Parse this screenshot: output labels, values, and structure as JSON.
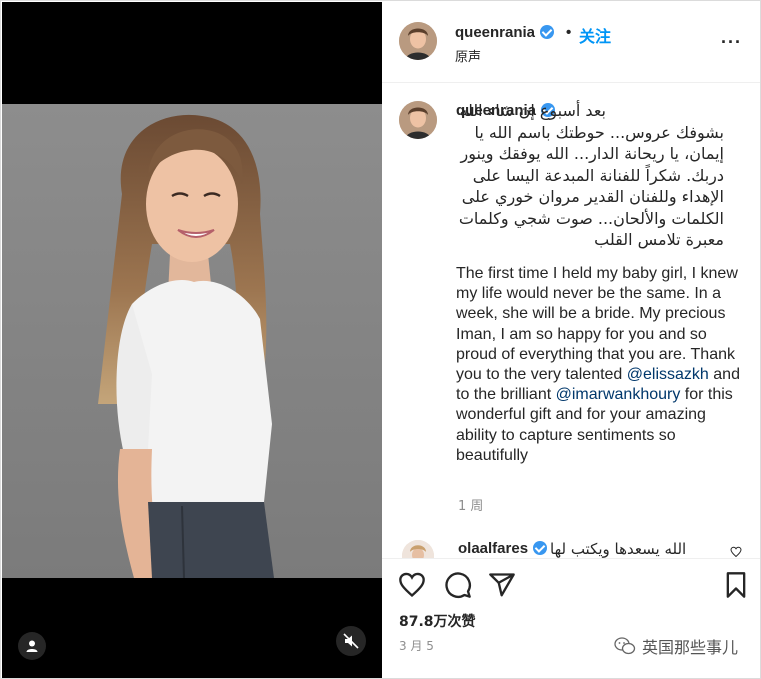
{
  "header": {
    "username": "queenrania",
    "dot": "•",
    "follow_label": "关注",
    "subtitle": "原声",
    "more": "..."
  },
  "caption": {
    "username": "queenrania",
    "arabic_text": "بعد أسبوع إن شاء الله بشوفك عروس... حوطتك باسم الله يا إيمان، يا ريحانة الدار... الله يوفقك وينور دربك. شكراً للفنانة المبدعة اليسا على الإهداء وللفنان القدير مروان خوري على الكلمات والألحان... صوت شجي وكلمات معبرة تلامس القلب",
    "english_1": "The first time I held my baby girl, I knew my life would never be the same. In a week, she will be a bride. My precious Iman, I am so happy for you and so proud of everything that you are. Thank you to the very talented ",
    "mention_1": "@elissazkh",
    "english_2": " and to the brilliant ",
    "mention_2": "@imarwankhoury",
    "english_3": " for this wonderful gift and for your amazing ability to capture sentiments so beautifully",
    "time_ago": "1 周"
  },
  "comment": {
    "username": "olaalfares",
    "text": "الله يسعدها ويكتب لها"
  },
  "footer": {
    "likes": "87.8万次赞",
    "date": "3 月 5",
    "watermark": "英国那些事儿"
  },
  "icons": {
    "like": "heart-icon",
    "comment": "comment-icon",
    "share": "share-icon",
    "save": "bookmark-icon",
    "tag": "user-tag-icon",
    "mute": "muted-speaker-icon"
  },
  "colors": {
    "accent": "#0095f6",
    "verified": "#3897f0",
    "mention": "#00376b",
    "muted_text": "#8e8e8e"
  }
}
